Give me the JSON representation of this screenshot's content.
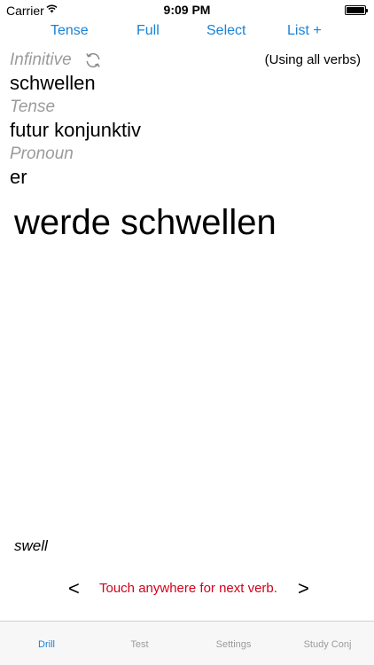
{
  "status_bar": {
    "carrier": "Carrier",
    "time": "9:09 PM"
  },
  "top_nav": {
    "tense": "Tense",
    "full": "Full",
    "select": "Select",
    "list": "List +"
  },
  "drill": {
    "infinitive_label": "Infinitive",
    "infinitive_value": "schwellen",
    "scope_note": "(Using all verbs)",
    "tense_label": "Tense",
    "tense_value": "futur konjunktiv",
    "pronoun_label": "Pronoun",
    "pronoun_value": "er",
    "conjugation": "werde schwellen",
    "translation": "swell",
    "prev": "<",
    "next": ">",
    "hint": "Touch anywhere for next verb."
  },
  "tab_bar": {
    "tabs": [
      {
        "label": "Drill",
        "active": true
      },
      {
        "label": "Test",
        "active": false
      },
      {
        "label": "Settings",
        "active": false
      },
      {
        "label": "Study Conj",
        "active": false
      }
    ]
  },
  "colors": {
    "accent": "#1a82d6",
    "hint": "#d0021b",
    "label_grey": "#9b9b9b"
  },
  "icons": [
    "wifi-icon",
    "battery-icon",
    "refresh-icon"
  ]
}
